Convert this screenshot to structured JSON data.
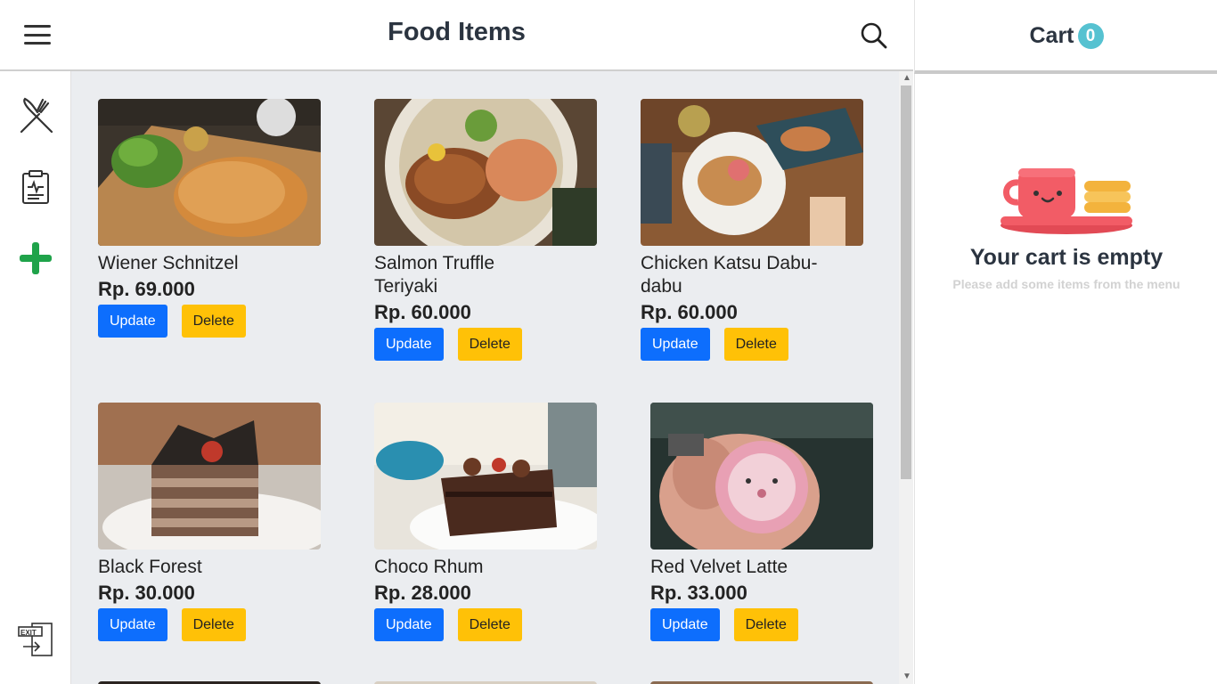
{
  "header": {
    "title": "Food Items"
  },
  "cart": {
    "title": "Cart",
    "count": "0",
    "empty_title": "Your cart is empty",
    "empty_subtitle": "Please add some items from the menu"
  },
  "buttons": {
    "update": "Update",
    "delete": "Delete"
  },
  "items": [
    {
      "name": "Wiener Schnitzel",
      "price": "Rp. 69.000"
    },
    {
      "name": "Salmon Truffle Teriyaki",
      "price": "Rp. 60.000"
    },
    {
      "name": "Chicken Katsu Dabu-dabu",
      "price": "Rp. 60.000"
    },
    {
      "name": "Black Forest",
      "price": "Rp. 30.000"
    },
    {
      "name": "Choco Rhum",
      "price": "Rp. 28.000"
    },
    {
      "name": "Red Velvet Latte",
      "price": "Rp. 33.000"
    }
  ],
  "icons": {
    "menu": "hamburger-menu-icon",
    "search": "search-icon",
    "food": "fork-knife-icon",
    "report": "clipboard-icon",
    "add": "plus-icon",
    "logout": "exit-door-icon"
  },
  "colors": {
    "update": "#0d6efd",
    "delete": "#ffc107",
    "add": "#1fa34a",
    "badge": "#56c2d1"
  }
}
